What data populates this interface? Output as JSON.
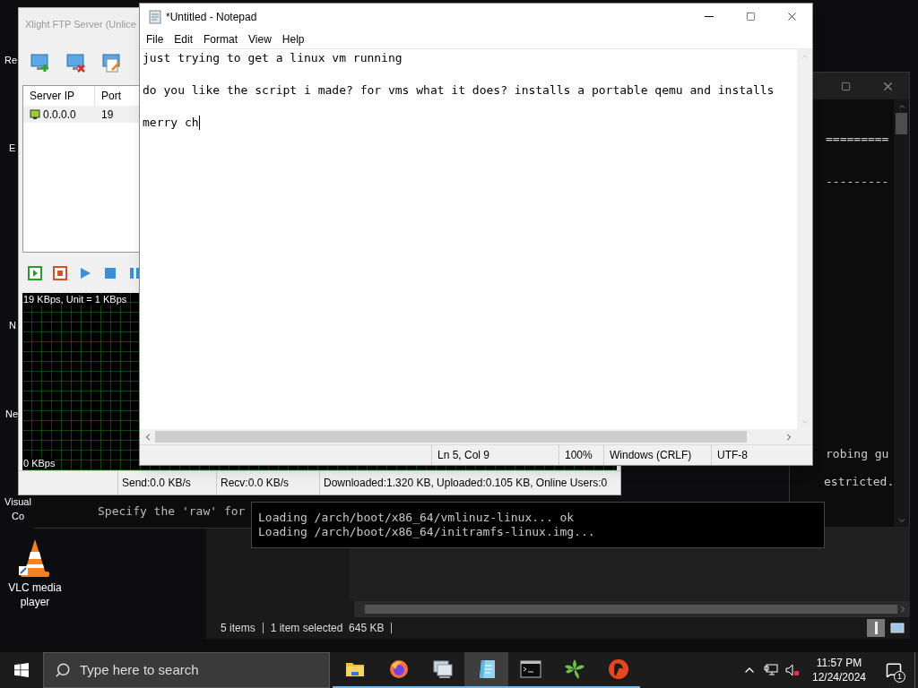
{
  "desktop_icons": [
    {
      "label": "Re"
    },
    {
      "label": "E"
    },
    {
      "label": "N"
    },
    {
      "label": "Ne"
    },
    {
      "label": "Visual Co"
    },
    {
      "label": "VLC media player",
      "kind": "vlc"
    }
  ],
  "console_window": {
    "lines": [
      "=========",
      "---------",
      "robing gu",
      "estricted."
    ]
  },
  "explorer_window": {
    "status": [
      "5 items",
      "1 item selected  645 KB"
    ]
  },
  "terminal_window": {
    "text": "Specify the 'raw' for"
  },
  "qemu_window": {
    "lines": [
      "Loading /arch/boot/x86_64/vmlinuz-linux... ok",
      "Loading /arch/boot/x86_64/initramfs-linux.img..."
    ]
  },
  "xlight_window": {
    "title": "Xlight FTP Server (Unlice",
    "columns": [
      "Server IP",
      "Port"
    ],
    "rows": [
      {
        "ip": "0.0.0.0",
        "port": "19",
        "selected": true
      }
    ],
    "graph": {
      "top_label": "19 KBps, Unit = 1 KBps",
      "bottom_label": "0 KBps"
    },
    "status": [
      "Send:0.0 KB/s",
      "Recv:0.0 KB/s",
      "Downloaded:1.320 KB, Uploaded:0.105 KB, Online Users:0"
    ]
  },
  "notepad": {
    "title": "*Untitled - Notepad",
    "menu": [
      "File",
      "Edit",
      "Format",
      "View",
      "Help"
    ],
    "lines": [
      "just trying to get a linux vm running",
      "do you like the script i made? for vms what it does? installs a portable qemu and installs",
      "merry ch"
    ],
    "status": [
      "Ln 5, Col 9",
      "100%",
      "Windows (CRLF)",
      "UTF-8"
    ]
  },
  "taskbar": {
    "search_placeholder": "Type here to search",
    "apps": [
      {
        "kind": "folder",
        "selected": false
      },
      {
        "kind": "firefox",
        "selected": false
      },
      {
        "kind": "network",
        "selected": false
      },
      {
        "kind": "notepad",
        "selected": true
      },
      {
        "kind": "terminal",
        "selected": false
      },
      {
        "kind": "leaf",
        "selected": false
      },
      {
        "kind": "parrot",
        "selected": false
      }
    ],
    "time": "11:57 PM",
    "date": "12/24/2024",
    "notifications": "1"
  }
}
